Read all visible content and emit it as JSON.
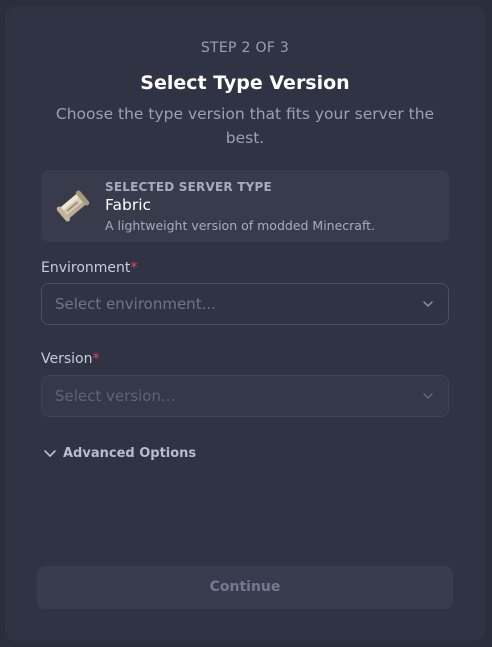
{
  "header": {
    "step": "STEP 2 OF 3",
    "title": "Select Type Version",
    "subtitle": "Choose the type version that fits your server the best."
  },
  "selected_type": {
    "kicker": "SELECTED SERVER TYPE",
    "name": "Fabric",
    "description": "A lightweight version of modded Minecraft.",
    "icon": "fabric-scroll-icon"
  },
  "environment": {
    "label": "Environment",
    "required_mark": "*",
    "placeholder": "Select environment..."
  },
  "version": {
    "label": "Version",
    "required_mark": "*",
    "placeholder": "Select version...",
    "disabled": true
  },
  "advanced": {
    "label": "Advanced Options",
    "icon": "chevron-down-icon"
  },
  "footer": {
    "continue_label": "Continue",
    "disabled": true
  },
  "colors": {
    "background": "#2b2f3d",
    "panel": "#2f3343",
    "required": "#e5484d"
  }
}
